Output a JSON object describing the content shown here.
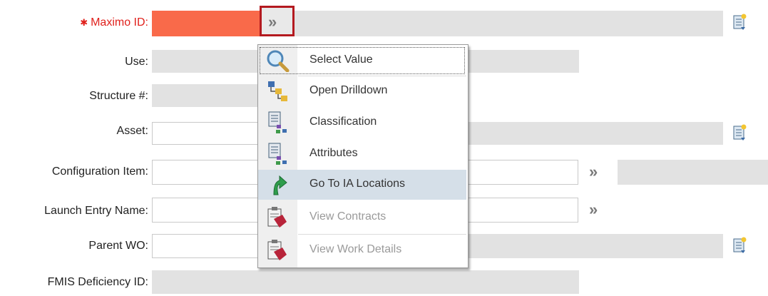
{
  "form": {
    "maximo_id": {
      "label": "Maximo ID:",
      "required_marker": "✱"
    },
    "use": {
      "label": "Use:"
    },
    "structure": {
      "label": "Structure #:"
    },
    "asset": {
      "label": "Asset:"
    },
    "config_item": {
      "label": "Configuration Item:"
    },
    "launch_entry": {
      "label": "Launch Entry Name:"
    },
    "parent_wo": {
      "label": "Parent WO:"
    },
    "fmis": {
      "label": "FMIS Deficiency ID:"
    },
    "lookup_glyph": "»"
  },
  "menu": {
    "items": [
      {
        "label": "Select Value",
        "icon": "magnifier-icon",
        "enabled": true
      },
      {
        "label": "Open Drilldown",
        "icon": "drilldown-icon",
        "enabled": true
      },
      {
        "label": "Classification",
        "icon": "classification-icon",
        "enabled": true
      },
      {
        "label": "Attributes",
        "icon": "attributes-icon",
        "enabled": true
      },
      {
        "label": "Go To IA Locations",
        "icon": "goto-arrow-icon",
        "enabled": true
      },
      {
        "label": "View Contracts",
        "icon": "clipboard-icon",
        "enabled": false
      },
      {
        "label": "View Work Details",
        "icon": "clipboard-icon",
        "enabled": false
      }
    ]
  },
  "colors": {
    "required_field": "#f96a4a",
    "required_label": "#e0201b",
    "focus_border": "#b4191f",
    "menu_hover": "#d5dfe8"
  }
}
